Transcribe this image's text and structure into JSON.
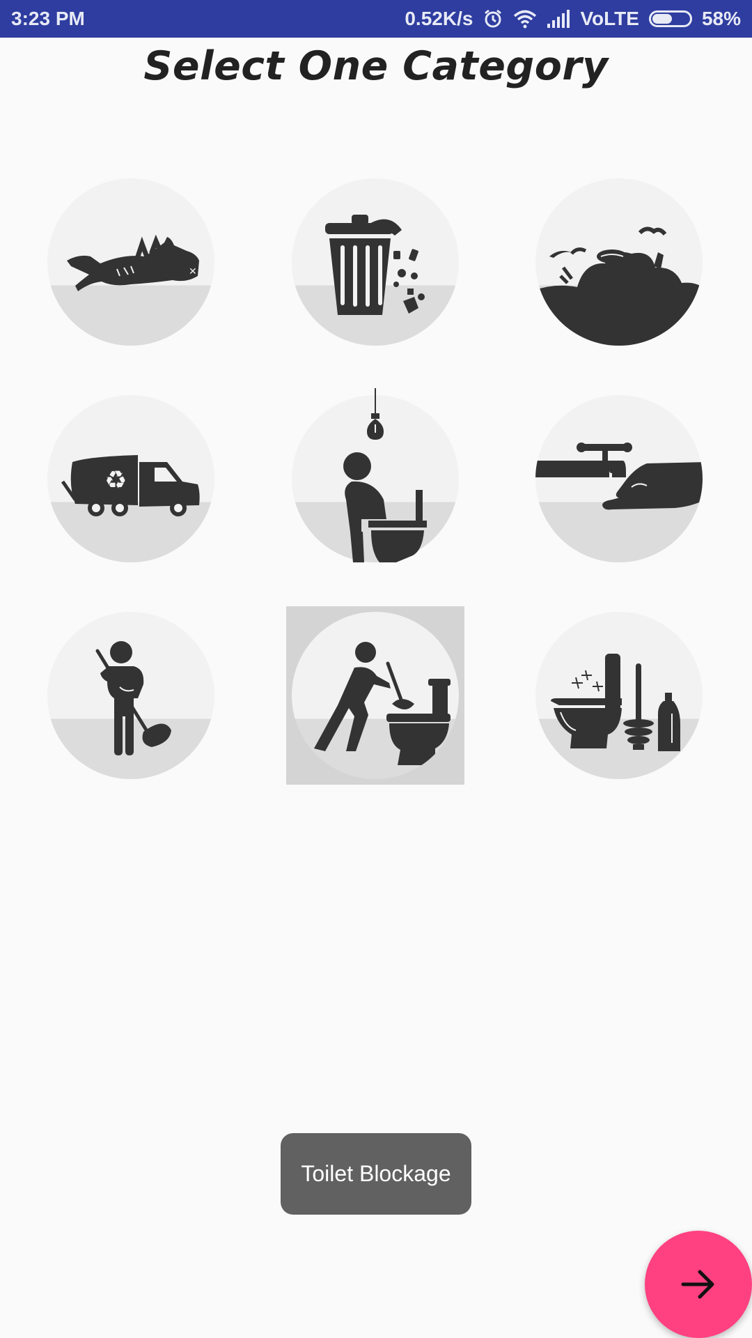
{
  "status_bar": {
    "time": "3:23 PM",
    "network_speed": "0.52K/s",
    "network_type": "VoLTE",
    "battery_percent": "58%",
    "battery_level": 0.58,
    "icons": [
      "alarm-icon",
      "wifi-icon",
      "signal-icon",
      "battery-icon"
    ]
  },
  "page": {
    "title": "Select One Category"
  },
  "categories": [
    {
      "icon": "dead-animal-icon",
      "selected": false
    },
    {
      "icon": "overflowing-dustbin-icon",
      "selected": false
    },
    {
      "icon": "garbage-dump-icon",
      "selected": false
    },
    {
      "icon": "garbage-truck-icon",
      "selected": false
    },
    {
      "icon": "no-electricity-toilet-icon",
      "selected": false
    },
    {
      "icon": "no-water-supply-icon",
      "selected": false
    },
    {
      "icon": "sweeper-icon",
      "selected": false
    },
    {
      "icon": "toilet-blockage-icon",
      "selected": true
    },
    {
      "icon": "toilet-cleaning-icon",
      "selected": false
    }
  ],
  "toast": {
    "text": "Toilet Blockage"
  },
  "fab": {
    "icon": "arrow-right-icon"
  },
  "colors": {
    "status_bar": "#2e3d9f",
    "accent": "#ff4081",
    "toast_bg": "#616161",
    "icon": "#333333",
    "selected_bg": "#d4d4d4"
  }
}
